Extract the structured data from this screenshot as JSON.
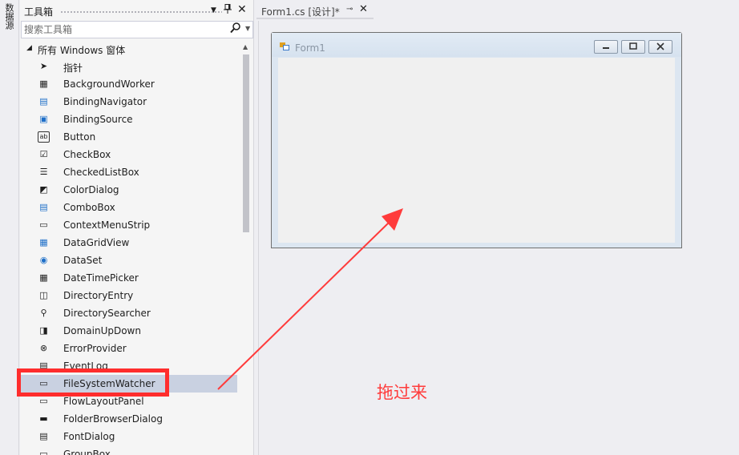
{
  "side_strip": {
    "tab_label": "数据源"
  },
  "toolbox": {
    "title": "工具箱",
    "search_placeholder": "搜索工具箱",
    "group_label": "所有 Windows 窗体",
    "items": [
      {
        "label": "指针",
        "icon": "pointer-arrow-icon"
      },
      {
        "label": "BackgroundWorker",
        "icon": "background-worker-icon"
      },
      {
        "label": "BindingNavigator",
        "icon": "binding-navigator-icon"
      },
      {
        "label": "BindingSource",
        "icon": "binding-source-icon"
      },
      {
        "label": "Button",
        "icon": "button-ab-icon"
      },
      {
        "label": "CheckBox",
        "icon": "checkbox-icon"
      },
      {
        "label": "CheckedListBox",
        "icon": "checked-list-icon"
      },
      {
        "label": "ColorDialog",
        "icon": "color-dialog-icon"
      },
      {
        "label": "ComboBox",
        "icon": "combobox-icon"
      },
      {
        "label": "ContextMenuStrip",
        "icon": "context-menu-icon"
      },
      {
        "label": "DataGridView",
        "icon": "datagrid-icon"
      },
      {
        "label": "DataSet",
        "icon": "dataset-icon"
      },
      {
        "label": "DateTimePicker",
        "icon": "calendar-icon"
      },
      {
        "label": "DirectoryEntry",
        "icon": "directory-entry-icon"
      },
      {
        "label": "DirectorySearcher",
        "icon": "magnifier-icon"
      },
      {
        "label": "DomainUpDown",
        "icon": "updown-icon"
      },
      {
        "label": "ErrorProvider",
        "icon": "error-x-icon"
      },
      {
        "label": "EventLog",
        "icon": "eventlog-icon"
      },
      {
        "label": "FileSystemWatcher",
        "icon": "filesystem-watcher-icon",
        "selected": true
      },
      {
        "label": "FlowLayoutPanel",
        "icon": "flow-layout-icon"
      },
      {
        "label": "FolderBrowserDialog",
        "icon": "folder-browser-icon"
      },
      {
        "label": "FontDialog",
        "icon": "font-dialog-icon"
      },
      {
        "label": "GroupBox",
        "icon": "groupbox-icon"
      }
    ]
  },
  "document_tab": {
    "title": "Form1.cs [设计]*"
  },
  "form": {
    "title": "Form1"
  },
  "annotation": {
    "text": "拖过来",
    "color": "#ff3b3b"
  },
  "colors": {
    "selection": "#c9d1e1",
    "highlight_box": "#ff2d2d"
  }
}
